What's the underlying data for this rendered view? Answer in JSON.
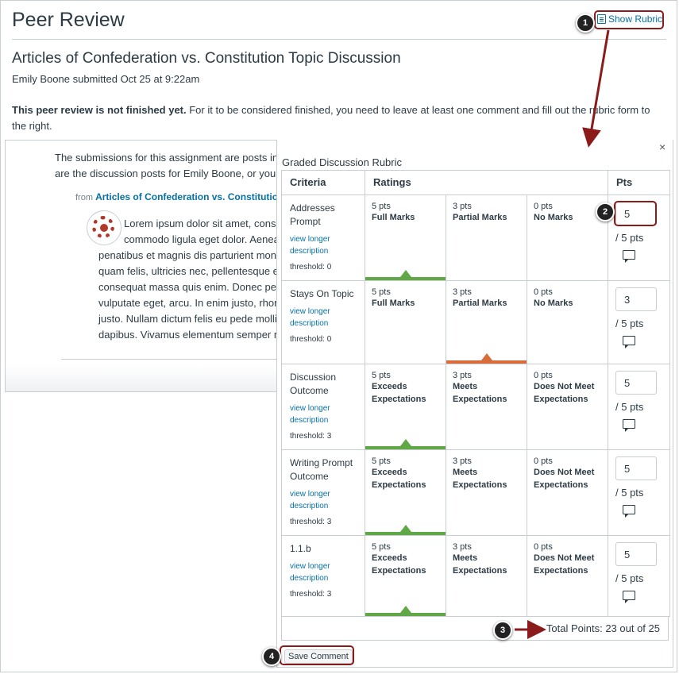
{
  "header": {
    "page_title": "Peer Review",
    "show_rubric_label": "Show Rubric",
    "assignment_title": "Articles of Confederation vs. Constitution Topic Discussion",
    "submitted_line": "Emily Boone submitted Oct 25 at 9:22am",
    "notice_bold": "This peer review is not finished yet.",
    "notice_rest": " For it to be considered finished, you need to leave at least one comment and fill out the rubric form to the right."
  },
  "discussion": {
    "intro_line1": "The submissions for this assignment are posts in t",
    "intro_line2": "are the discussion posts for Emily Boone, or you c",
    "from_label": "from",
    "from_link": "Articles of Confederation vs. Constitution",
    "lorem": [
      "Lorem ipsum dolor sit amet, conse",
      "commodo ligula eget dolor. Aenea",
      "penatibus et magnis dis parturient monte",
      "quam felis, ultricies nec, pellentesque eu,",
      "consequat massa quis enim. Donec pede",
      "vulputate eget, arcu. In enim justo, rhonc",
      "justo. Nullam dictum felis eu pede mollis",
      "dapibus. Vivamus elementum semper nis"
    ]
  },
  "rubric": {
    "close_glyph": "×",
    "title": "Graded Discussion Rubric",
    "headers": {
      "criteria": "Criteria",
      "ratings": "Ratings",
      "pts": "Pts"
    },
    "rows": [
      {
        "name": "Addresses Prompt",
        "link": "view longer description",
        "threshold": "threshold: 0",
        "ratings": [
          {
            "pts": "5 pts",
            "desc": "Full Marks"
          },
          {
            "pts": "3 pts",
            "desc": "Partial Marks"
          },
          {
            "pts": "0 pts",
            "desc": "No Marks"
          }
        ],
        "selected": 0,
        "selected_color": "#5fa845",
        "score": "5",
        "outof": "/ 5 pts"
      },
      {
        "name": "Stays On Topic",
        "link": "view longer description",
        "threshold": "threshold: 0",
        "ratings": [
          {
            "pts": "5 pts",
            "desc": "Full Marks"
          },
          {
            "pts": "3 pts",
            "desc": "Partial Marks"
          },
          {
            "pts": "0 pts",
            "desc": "No Marks"
          }
        ],
        "selected": 1,
        "selected_color": "#d86c3a",
        "score": "3",
        "outof": "/ 5 pts"
      },
      {
        "name": "Discussion Outcome",
        "link": "view longer description",
        "threshold": "threshold: 3",
        "ratings": [
          {
            "pts": "5 pts",
            "desc": "Exceeds Expectations"
          },
          {
            "pts": "3 pts",
            "desc": "Meets Expectations"
          },
          {
            "pts": "0 pts",
            "desc": "Does Not Meet Expectations"
          }
        ],
        "selected": 0,
        "selected_color": "#5fa845",
        "score": "5",
        "outof": "/ 5 pts"
      },
      {
        "name": "Writing Prompt Outcome",
        "link": "view longer description",
        "threshold": "threshold: 3",
        "ratings": [
          {
            "pts": "5 pts",
            "desc": "Exceeds Expectations"
          },
          {
            "pts": "3 pts",
            "desc": "Meets Expectations"
          },
          {
            "pts": "0 pts",
            "desc": "Does Not Meet Expectations"
          }
        ],
        "selected": 0,
        "selected_color": "#5fa845",
        "score": "5",
        "outof": "/ 5 pts"
      },
      {
        "name": "1.1.b",
        "link": "view longer description",
        "threshold": "threshold: 3",
        "ratings": [
          {
            "pts": "5 pts",
            "desc": "Exceeds Expectations"
          },
          {
            "pts": "3 pts",
            "desc": "Meets Expectations"
          },
          {
            "pts": "0 pts",
            "desc": "Does Not Meet Expectations"
          }
        ],
        "selected": 0,
        "selected_color": "#5fa845",
        "score": "5",
        "outof": "/ 5 pts"
      }
    ],
    "total": "Total Points: 23 out of 25",
    "save_comment": "Save Comment"
  },
  "callouts": [
    "1",
    "2",
    "3",
    "4"
  ],
  "colors": {
    "callout_red": "#8b1a1a",
    "link_blue": "#0770a3"
  }
}
